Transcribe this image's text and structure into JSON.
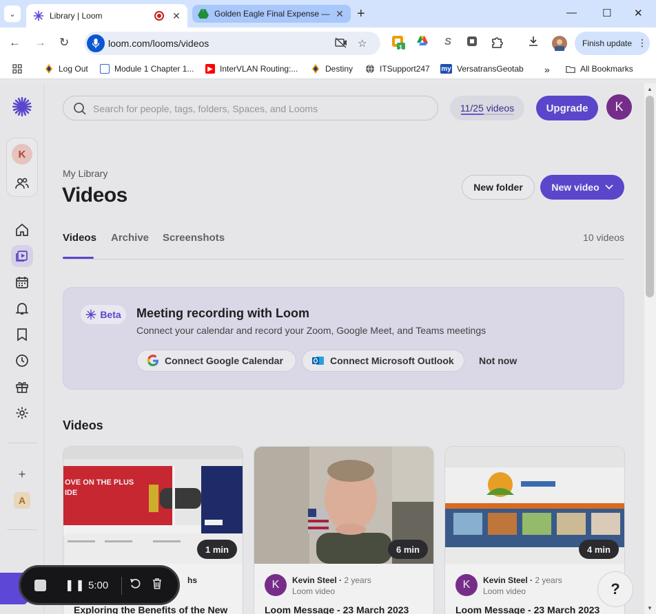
{
  "browser": {
    "tabs": [
      {
        "title": "Library | Loom",
        "active": true
      },
      {
        "title": "Golden Eagle Final Expense — ",
        "active": false
      }
    ],
    "url": "loom.com/looms/videos",
    "finish_update_label": "Finish update",
    "extension_badge": "1",
    "bookmarks": [
      {
        "label": "Log Out",
        "icon": "flame-icon"
      },
      {
        "label": "Module 1 Chapter 1...",
        "icon": "doc-icon"
      },
      {
        "label": "InterVLAN Routing:...",
        "icon": "youtube-icon"
      },
      {
        "label": "Destiny",
        "icon": "flame-icon"
      },
      {
        "label": "ITSupport247",
        "icon": "globe-icon"
      },
      {
        "label": "VersatransGeotab",
        "icon": "my-icon"
      }
    ],
    "all_bookmarks_label": "All Bookmarks"
  },
  "app": {
    "search_placeholder": "Search for people, tags, folders, Spaces, and Looms",
    "usage": "11/25 videos",
    "usage_fraction": 0.44,
    "upgrade_label": "Upgrade",
    "avatar_initial": "K",
    "sidebar_initial": "K",
    "sidebar_workspace_initial": "A",
    "breadcrumb": "My Library",
    "title": "Videos",
    "new_folder_label": "New folder",
    "new_video_label": "New video",
    "tabs": [
      "Videos",
      "Archive",
      "Screenshots"
    ],
    "video_count": "10 videos",
    "banner": {
      "badge": "Beta",
      "title": "Meeting recording with Loom",
      "subtitle": "Connect your calendar and record your Zoom, Google Meet, and Teams meetings",
      "google_btn": "Connect Google Calendar",
      "outlook_btn": "Connect Microsoft Outlook",
      "not_now": "Not now"
    },
    "section_title": "Videos",
    "cards": [
      {
        "duration": "1 min",
        "author": "",
        "age": "",
        "sub": "",
        "title": "Exploring the Benefits of the New",
        "partial_meta": "hs"
      },
      {
        "duration": "6 min",
        "author": "Kevin Steel",
        "age": "2 years",
        "sub": "Loom video",
        "title": "Loom Message - 23 March 2023"
      },
      {
        "duration": "4 min",
        "author": "Kevin Steel",
        "age": "2 years",
        "sub": "Loom video",
        "title": "Loom Message - 23 March 2023"
      }
    ],
    "help_label": "?"
  },
  "recorder": {
    "time": "5:00"
  },
  "colors": {
    "accent": "#5d47d6",
    "avatar": "#7b2d8f"
  }
}
